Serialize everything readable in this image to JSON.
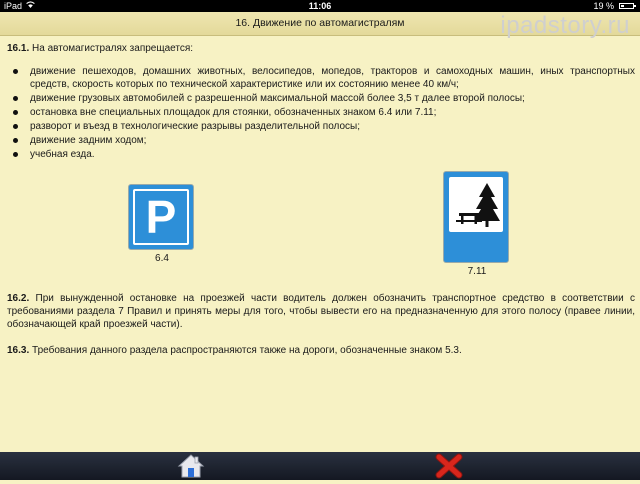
{
  "status_bar": {
    "carrier": "iPad",
    "time": "11:06",
    "battery": "19 %"
  },
  "header": {
    "title": "16. Движение по автомагистралям",
    "watermark": "ipadstory.ru"
  },
  "section1": {
    "number": "16.1.",
    "text": "На автомагистралях запрещается:",
    "items": [
      "движение пешеходов, домашних животных, велосипедов, мопедов, тракторов и самоходных машин, иных транспортных средств, скорость которых по технической характеристике или их состоянию менее 40 км/ч;",
      "движение грузовых автомобилей с разрешенной максимальной массой более 3,5 т далее второй полосы;",
      "остановка вне специальных площадок для стоянки, обозначенных знаком 6.4 или 7.11;",
      "разворот и въезд в технологические разрывы разделительной полосы;",
      "движение задним ходом;",
      "учебная езда."
    ]
  },
  "signs": {
    "parking": {
      "glyph": "P",
      "label": "6.4"
    },
    "rest": {
      "label": "7.11"
    }
  },
  "section2": {
    "number": "16.2.",
    "text": "При вынужденной остановке на проезжей части водитель должен обозначить транспортное средство в соответствии с требованиями раздела 7 Правил и принять меры для того, чтобы вывести его на предназначенную для этого полосу (правее линии, обозначающей край проезжей части)."
  },
  "section3": {
    "number": "16.3.",
    "text": "Требования данного раздела распространяются также на дороги, обозначенные знаком 5.3."
  },
  "toolbar": {
    "home_icon": "home-icon",
    "close_icon": "close-icon"
  },
  "colors": {
    "page_bg": "#f7f2c4",
    "sign_blue": "#2d8fd8",
    "close_red": "#d8261c"
  }
}
